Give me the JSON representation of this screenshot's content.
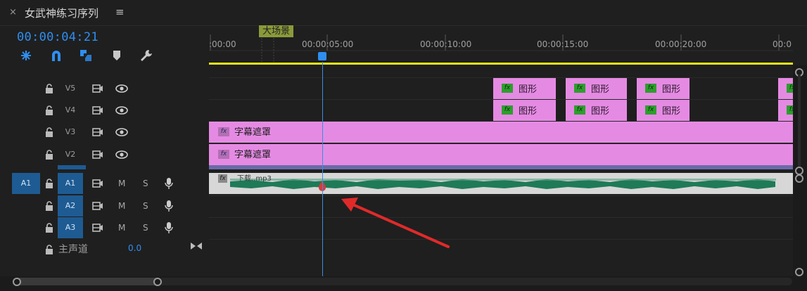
{
  "panel": {
    "close_glyph": "×",
    "title": "女武神练习序列",
    "menu_glyph": "≡",
    "timecode": "00:00:04:21"
  },
  "toolbar": {
    "icons": [
      "insert-overwrite-icon",
      "snap-magnet-icon",
      "linked-selection-icon",
      "add-marker-icon",
      "wrench-settings-icon"
    ]
  },
  "ruler": {
    "labels": [
      ":00:00",
      "00:00:05:00",
      "00:00:10:00",
      "00:00:15:00",
      "00:00:20:00",
      "00:0"
    ],
    "marker_label": "大场景"
  },
  "tracks": {
    "video": [
      {
        "name": "V5"
      },
      {
        "name": "V4"
      },
      {
        "name": "V3"
      },
      {
        "name": "V2"
      }
    ],
    "audio": [
      {
        "name": "A1",
        "source": "A1",
        "m": "M",
        "s": "S"
      },
      {
        "name": "A2",
        "m": "M",
        "s": "S"
      },
      {
        "name": "A3",
        "m": "M",
        "s": "S"
      }
    ],
    "master": {
      "label": "主声道",
      "value": "0.0"
    }
  },
  "clips": {
    "fx_label": "fx",
    "graphic_name": "图形",
    "subtitle_name": "字幕遮罩",
    "audio_name": "下载..mp3"
  },
  "colors": {
    "accent": "#2e8ff0",
    "graphic_clip": "#e58ae3",
    "audio_wave": "#1f7a57",
    "work_area": "#e6e61c",
    "arrow": "#e02a2a"
  }
}
